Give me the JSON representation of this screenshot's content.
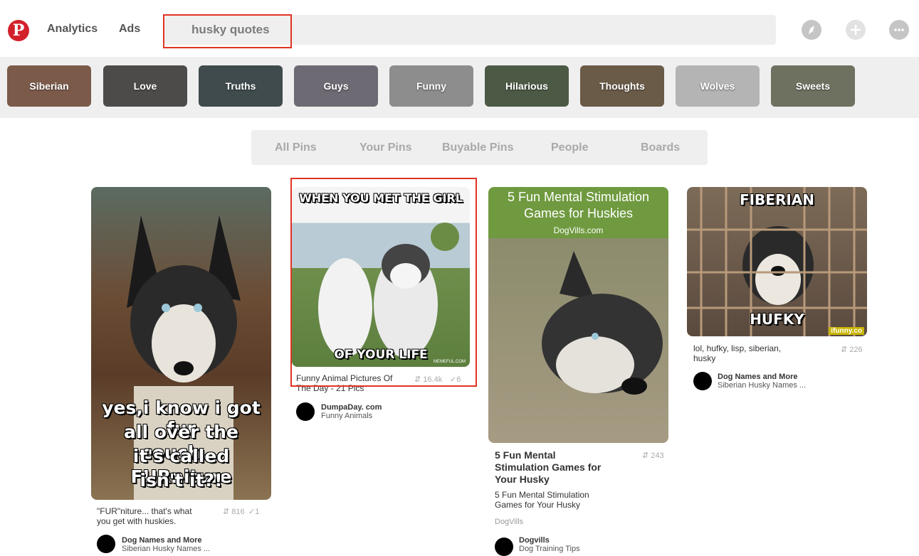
{
  "header": {
    "logo_letter": "P",
    "nav": [
      "Analytics",
      "Ads"
    ],
    "search": {
      "value": "husky quotes"
    },
    "icons": [
      "compass-icon",
      "plus-icon",
      "messages-icon"
    ]
  },
  "guides": [
    {
      "label": "Siberian",
      "color": "#7b5a4a"
    },
    {
      "label": "Love",
      "color": "#4d4b4a"
    },
    {
      "label": "Truths",
      "color": "#3f4b4d"
    },
    {
      "label": "Guys",
      "color": "#6e6a73"
    },
    {
      "label": "Funny",
      "color": "#8d8d8d"
    },
    {
      "label": "Hilarious",
      "color": "#4c5a45"
    },
    {
      "label": "Thoughts",
      "color": "#6a5a48"
    },
    {
      "label": "Wolves",
      "color": "#b4b4b4"
    },
    {
      "label": "Sweets",
      "color": "#6e7060"
    }
  ],
  "filters": [
    "All Pins",
    "Your Pins",
    "Buyable Pins",
    "People",
    "Boards"
  ],
  "pins": [
    {
      "meme_lines": [
        "yes,i know i got fur",
        "all over the couch...",
        "it's called FURniture",
        "isn't it?!"
      ],
      "description": "\"FUR\"niture... that's what you get with huskies.",
      "repins": "816",
      "likes": "1",
      "pinner": "Dog Names and More",
      "board": "Siberian Husky Names ..."
    },
    {
      "meme_top": "WHEN YOU MET THE GIRL",
      "meme_bottom": "OF YOUR LIFE",
      "watermark": "MEMEFUL.COM",
      "description": "Funny Animal Pictures Of The Day - 21 Pics",
      "repins": "16.4k",
      "likes": "6",
      "pinner": "DumpaDay. com",
      "board": "Funny Animals"
    },
    {
      "image_title": "5 Fun Mental Stimulation Games for Huskies",
      "image_site": "DogVills.com",
      "title": "5 Fun Mental Stimulation Games for Your Husky",
      "description": "5 Fun Mental Stimulation Games for Your Husky",
      "source": "DogVills",
      "repins": "243",
      "pinner": "Dogvills",
      "board": "Dog Training Tips"
    },
    {
      "meme_top": "FIBERIAN",
      "meme_bottom": "HUFKY",
      "watermark": "ifunny.co",
      "description": "lol, hufky, lisp, siberian, husky",
      "repins": "226",
      "pinner": "Dog Names and More",
      "board": "Siberian Husky Names ..."
    }
  ],
  "colors": {
    "brand": "#d3212c",
    "highlight": "#e03323",
    "strip": "#efefef"
  }
}
